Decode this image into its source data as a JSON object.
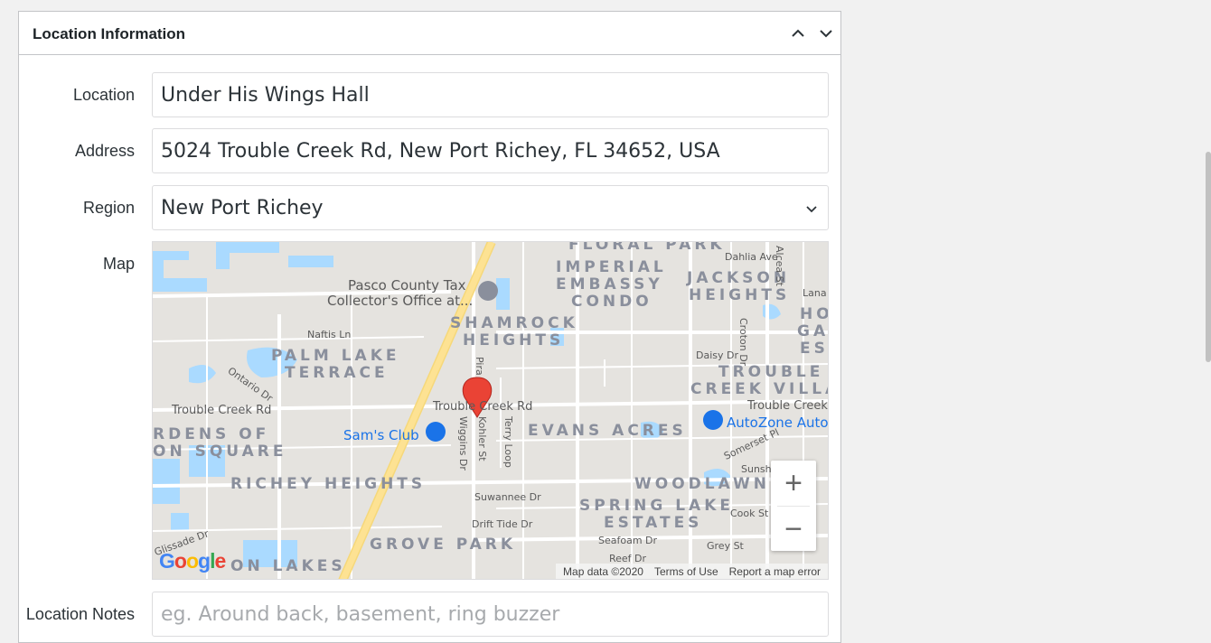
{
  "panel": {
    "title": "Location Information",
    "collapse_icon": "chevron-up-icon",
    "expand_icon": "chevron-down-icon"
  },
  "fields": {
    "location": {
      "label": "Location",
      "value": "Under His Wings Hall"
    },
    "address": {
      "label": "Address",
      "value": "5024 Trouble Creek Rd, New Port Richey, FL 34652, USA"
    },
    "region": {
      "label": "Region",
      "value": "New Port Richey"
    },
    "map": {
      "label": "Map"
    },
    "notes": {
      "label": "Location Notes",
      "placeholder": "eg. Around back, basement, ring buzzer"
    }
  },
  "map": {
    "areas": {
      "floral_park": "FLORAL PARK",
      "imperial_1": "IMPERIAL",
      "imperial_2": "EMBASSY",
      "imperial_3": "CONDO",
      "jackson_1": "JACKSON",
      "jackson_2": "HEIGHTS",
      "shamrock_1": "SHAMROCK",
      "shamrock_2": "HEIGHTS",
      "palm_1": "PALM LAKE",
      "palm_2": "TERRACE",
      "trouble_1": "TROUBLE",
      "trouble_2": "CREEK VILLA",
      "ho_1": "HO",
      "ho_2": "GA",
      "ho_3": "ES",
      "gardens_1": "RDENS OF",
      "gardens_2": "ON SQUARE",
      "evans": "EVANS ACRES",
      "richey": "RICHEY HEIGHTS",
      "woodlawn": "WOODLAWN",
      "spring_1": "SPRING LAKE",
      "spring_2": "ESTATES",
      "grove": "GROVE PARK",
      "lakes": "ON LAKES"
    },
    "streets": {
      "dahlia": "Dahlia Ave",
      "alcea": "Alcea St",
      "lana": "Lana",
      "naftis": "Naftis Ln",
      "ontario": "Ontario Dr",
      "crotona": "Croton Dr",
      "daisy": "Daisy Dr",
      "pira": "Pira",
      "trouble_main": "Trouble Creek Rd",
      "trouble_left": "Trouble Creek Rd",
      "trouble_right": "Trouble Creek",
      "wiggins": "Wiggins Dr",
      "kohler": "Kohler St",
      "terry": "Terry Loop",
      "somerset": "Somerset Pl",
      "sunshine": "Sunshi",
      "suwannee": "Suwannee Dr",
      "drift": "Drift Tide Dr",
      "cook": "Cook St",
      "seafoam": "Seafoam Dr",
      "grey": "Grey St",
      "reef": "Reef Dr",
      "glissade": "Glissade Dr"
    },
    "pois": {
      "pasco_1": "Pasco County Tax",
      "pasco_2": "Collector's Office at...",
      "sams": "Sam's Club",
      "autozone": "AutoZone Auto"
    },
    "zoom_in": "+",
    "zoom_out": "−",
    "logo": "Google",
    "attribution": {
      "data": "Map data ©2020",
      "terms": "Terms of Use",
      "report": "Report a map error"
    },
    "colors": {
      "land": "#e5e3df",
      "water": "#aadaff",
      "highway": "#fde293",
      "marker": "#ea4335"
    }
  }
}
